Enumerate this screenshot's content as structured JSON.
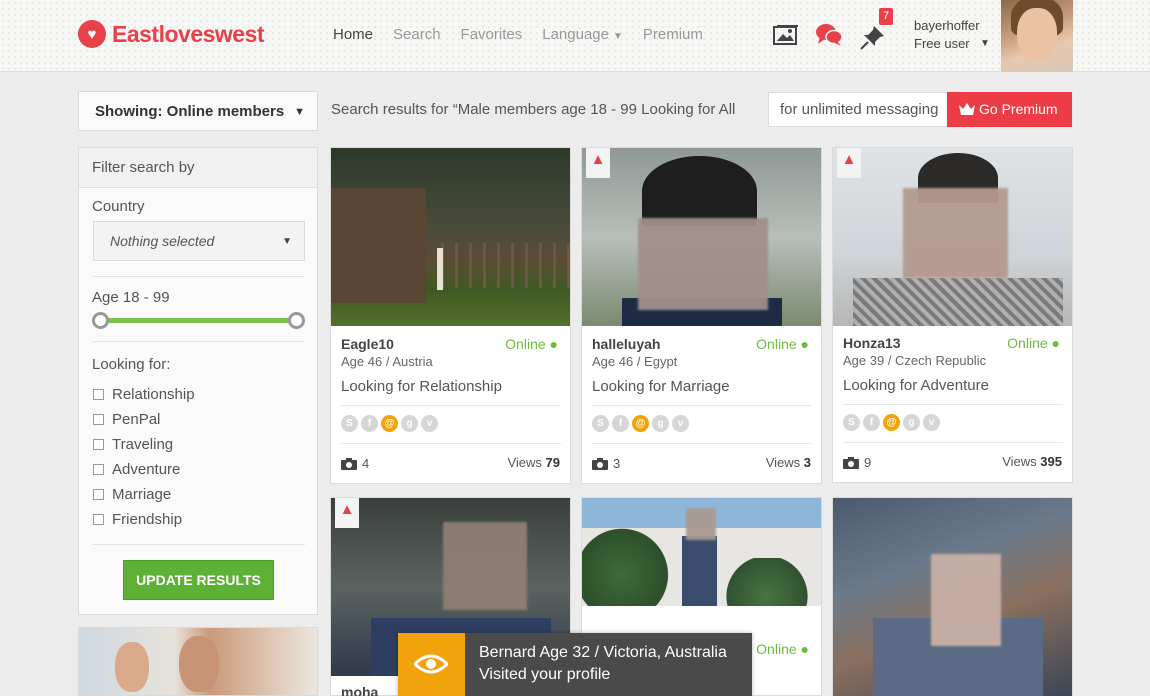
{
  "brand": {
    "name": "Eastloveswest",
    "accent": "#e8414a"
  },
  "nav": {
    "items": [
      {
        "label": "Home",
        "active": true
      },
      {
        "label": "Search",
        "active": false
      },
      {
        "label": "Favorites",
        "active": false
      },
      {
        "label": "Language",
        "active": false,
        "dropdown": true
      },
      {
        "label": "Premium",
        "active": false
      }
    ],
    "icons": [
      "photos-icon",
      "chat-bubbles-icon",
      "pin-icon"
    ],
    "notification_count": "7"
  },
  "user": {
    "username": "bayerhoffer",
    "plan": "Free user"
  },
  "toolbar": {
    "showing": "Showing: Online members",
    "search_results": "Search results for “Male members age 18 - 99 Looking for All",
    "premium_text": "for unlimited messaging",
    "go_premium": "Go Premium"
  },
  "filters": {
    "title": "Filter search by",
    "country_label": "Country",
    "country_value": "Nothing selected",
    "age_label": "Age 18 - 99",
    "age_min": 18,
    "age_max": 99,
    "looking_label": "Looking for:",
    "options": [
      "Relationship",
      "PenPal",
      "Traveling",
      "Adventure",
      "Marriage",
      "Friendship"
    ],
    "update_button": "UPDATE RESULTS"
  },
  "cards": [
    {
      "name": "Eagle10",
      "status": "Online",
      "age_country": "Age 46 / Austria",
      "looking": "Looking for Relationship",
      "photos": "4",
      "views_label": "Views",
      "views": "79",
      "hot": false
    },
    {
      "name": "halleluyah",
      "status": "Online",
      "age_country": "Age 46 / Egypt",
      "looking": "Looking for Marriage",
      "photos": "3",
      "views_label": "Views",
      "views": "3",
      "hot": true
    },
    {
      "name": "Honza13",
      "status": "Online",
      "age_country": "Age 39 / Czech Republic",
      "looking": "Looking for Adventure",
      "photos": "9",
      "views_label": "Views",
      "views": "395",
      "hot": true
    },
    {
      "name": "moha",
      "hot": true
    },
    {
      "status": "Online",
      "hot": false
    },
    {
      "hot": false
    }
  ],
  "toast": {
    "line1": "Bernard Age 32 / Victoria, Australia",
    "line2": "Visited your profile"
  },
  "colors": {
    "online": "#6cbd3c",
    "premium_button": "#ec3c45",
    "update_button": "#5db136",
    "toast_icon": "#f0a30a"
  }
}
